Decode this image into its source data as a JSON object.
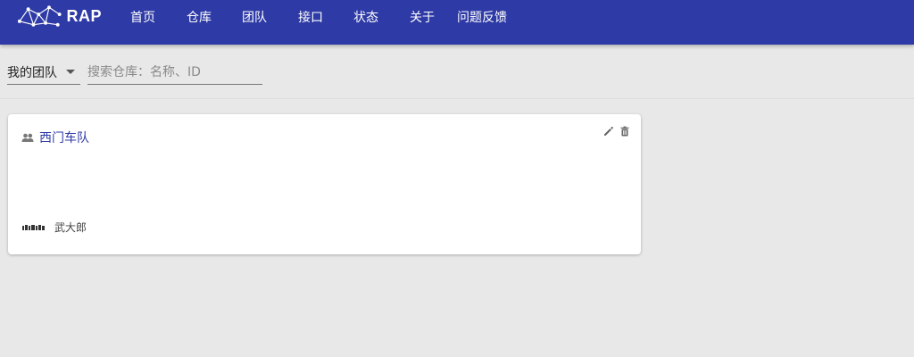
{
  "header": {
    "brand": "RAP",
    "nav": [
      {
        "label": "首页"
      },
      {
        "label": "仓库"
      },
      {
        "label": "团队"
      },
      {
        "label": "接口"
      },
      {
        "label": "状态"
      },
      {
        "label": "关于"
      },
      {
        "label": "问题反馈"
      }
    ],
    "bg_color": "#2e3aa5"
  },
  "toolbar": {
    "filter_label": "我的团队",
    "search_placeholder": "搜索仓库：名称、ID"
  },
  "teams": [
    {
      "name": "西门车队",
      "members": [
        {
          "name": "武大郎"
        }
      ]
    }
  ],
  "icons": {
    "team": "group-icon",
    "edit": "pencil-icon",
    "delete": "trash-icon"
  }
}
